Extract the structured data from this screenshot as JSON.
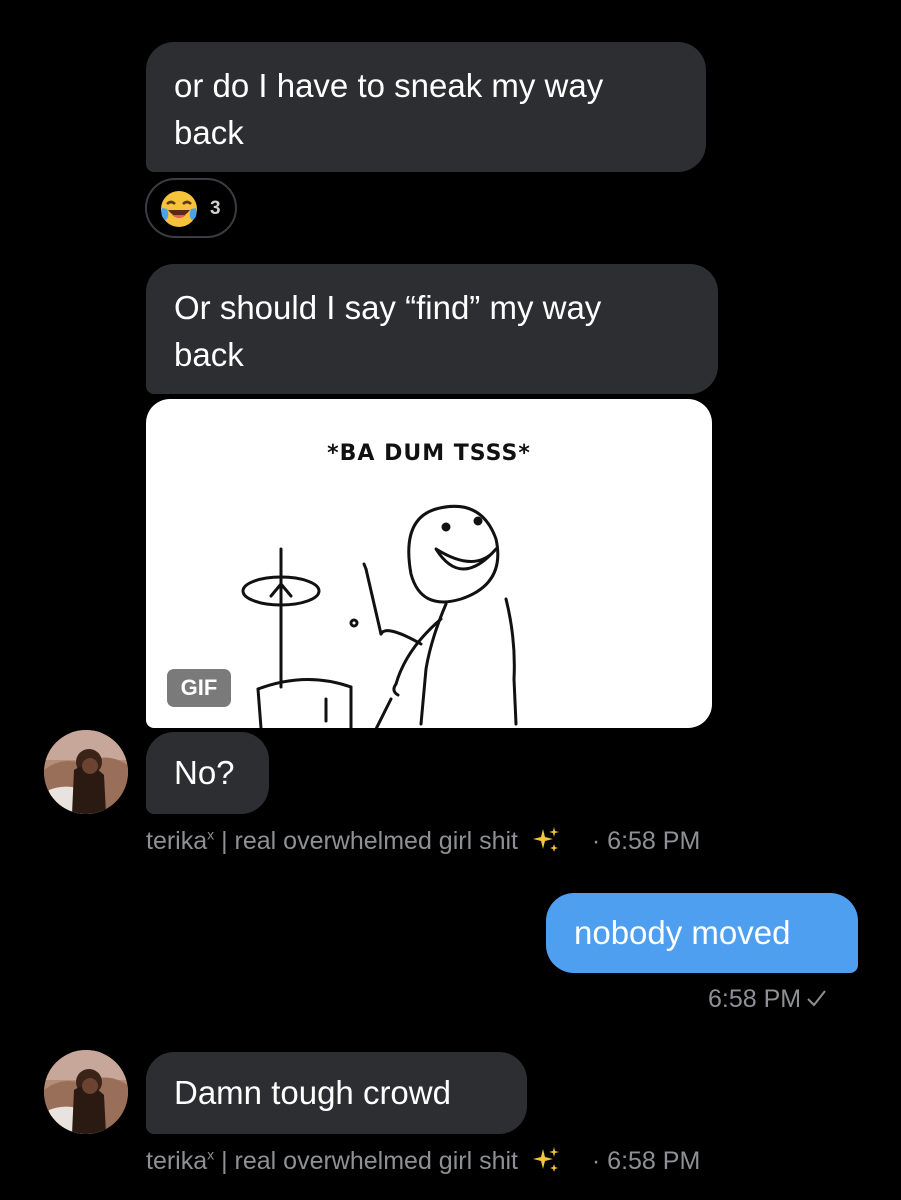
{
  "messages": [
    {
      "text": "or do I have to sneak my way back",
      "line1": "or do I have to sneak my way",
      "line2": "back"
    },
    {
      "text": "Or should I say “find” my way back",
      "line1": "Or should I say “find” my way",
      "line2": "back"
    },
    {
      "text": "No?"
    },
    {
      "text": "nobody moved"
    },
    {
      "text": "Damn tough crowd"
    }
  ],
  "reaction": {
    "emoji": "face-with-tears-of-joy-icon",
    "count": "3"
  },
  "gif": {
    "caption": "*BA DUM TSSS*",
    "badge": "GIF"
  },
  "meta": {
    "sender": "terika",
    "superscript": "x",
    "status": "| real overwhelmed girl shit",
    "time": "· 6:58 PM"
  },
  "sent_time": "6:58 PM",
  "colors": {
    "background": "#000000",
    "incoming_bubble": "#2c2e31",
    "outgoing_bubble": "#4f9ff0",
    "meta_text": "#8e9094"
  }
}
